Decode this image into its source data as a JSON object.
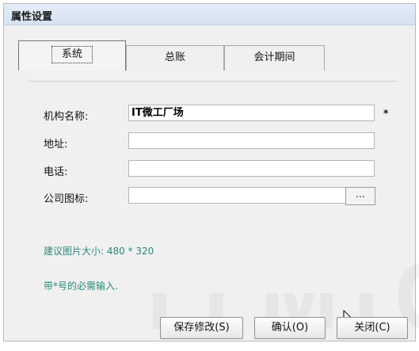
{
  "window": {
    "title": "属性设置"
  },
  "tabs": [
    {
      "label": "系统",
      "active": true
    },
    {
      "label": "总账",
      "active": false
    },
    {
      "label": "会计期间",
      "active": false
    }
  ],
  "form": {
    "org_name": {
      "label": "机构名称:",
      "value": "IT微工厂场",
      "required_mark": "*"
    },
    "address": {
      "label": "地址:",
      "value": ""
    },
    "phone": {
      "label": "电话:",
      "value": ""
    },
    "logo": {
      "label": "公司图标:",
      "value": "",
      "browse_label": "..."
    }
  },
  "hints": {
    "image_size": "建议图片大小: 480 * 320",
    "required_note": "带*号的必需输入."
  },
  "buttons": {
    "save": "保存修改(S)",
    "confirm": "确认(O)",
    "close": "关闭(C)"
  },
  "watermark": "ITMIC",
  "colors": {
    "hint_text": "#2a8a7e",
    "titlebar": "#d6e2f2"
  }
}
